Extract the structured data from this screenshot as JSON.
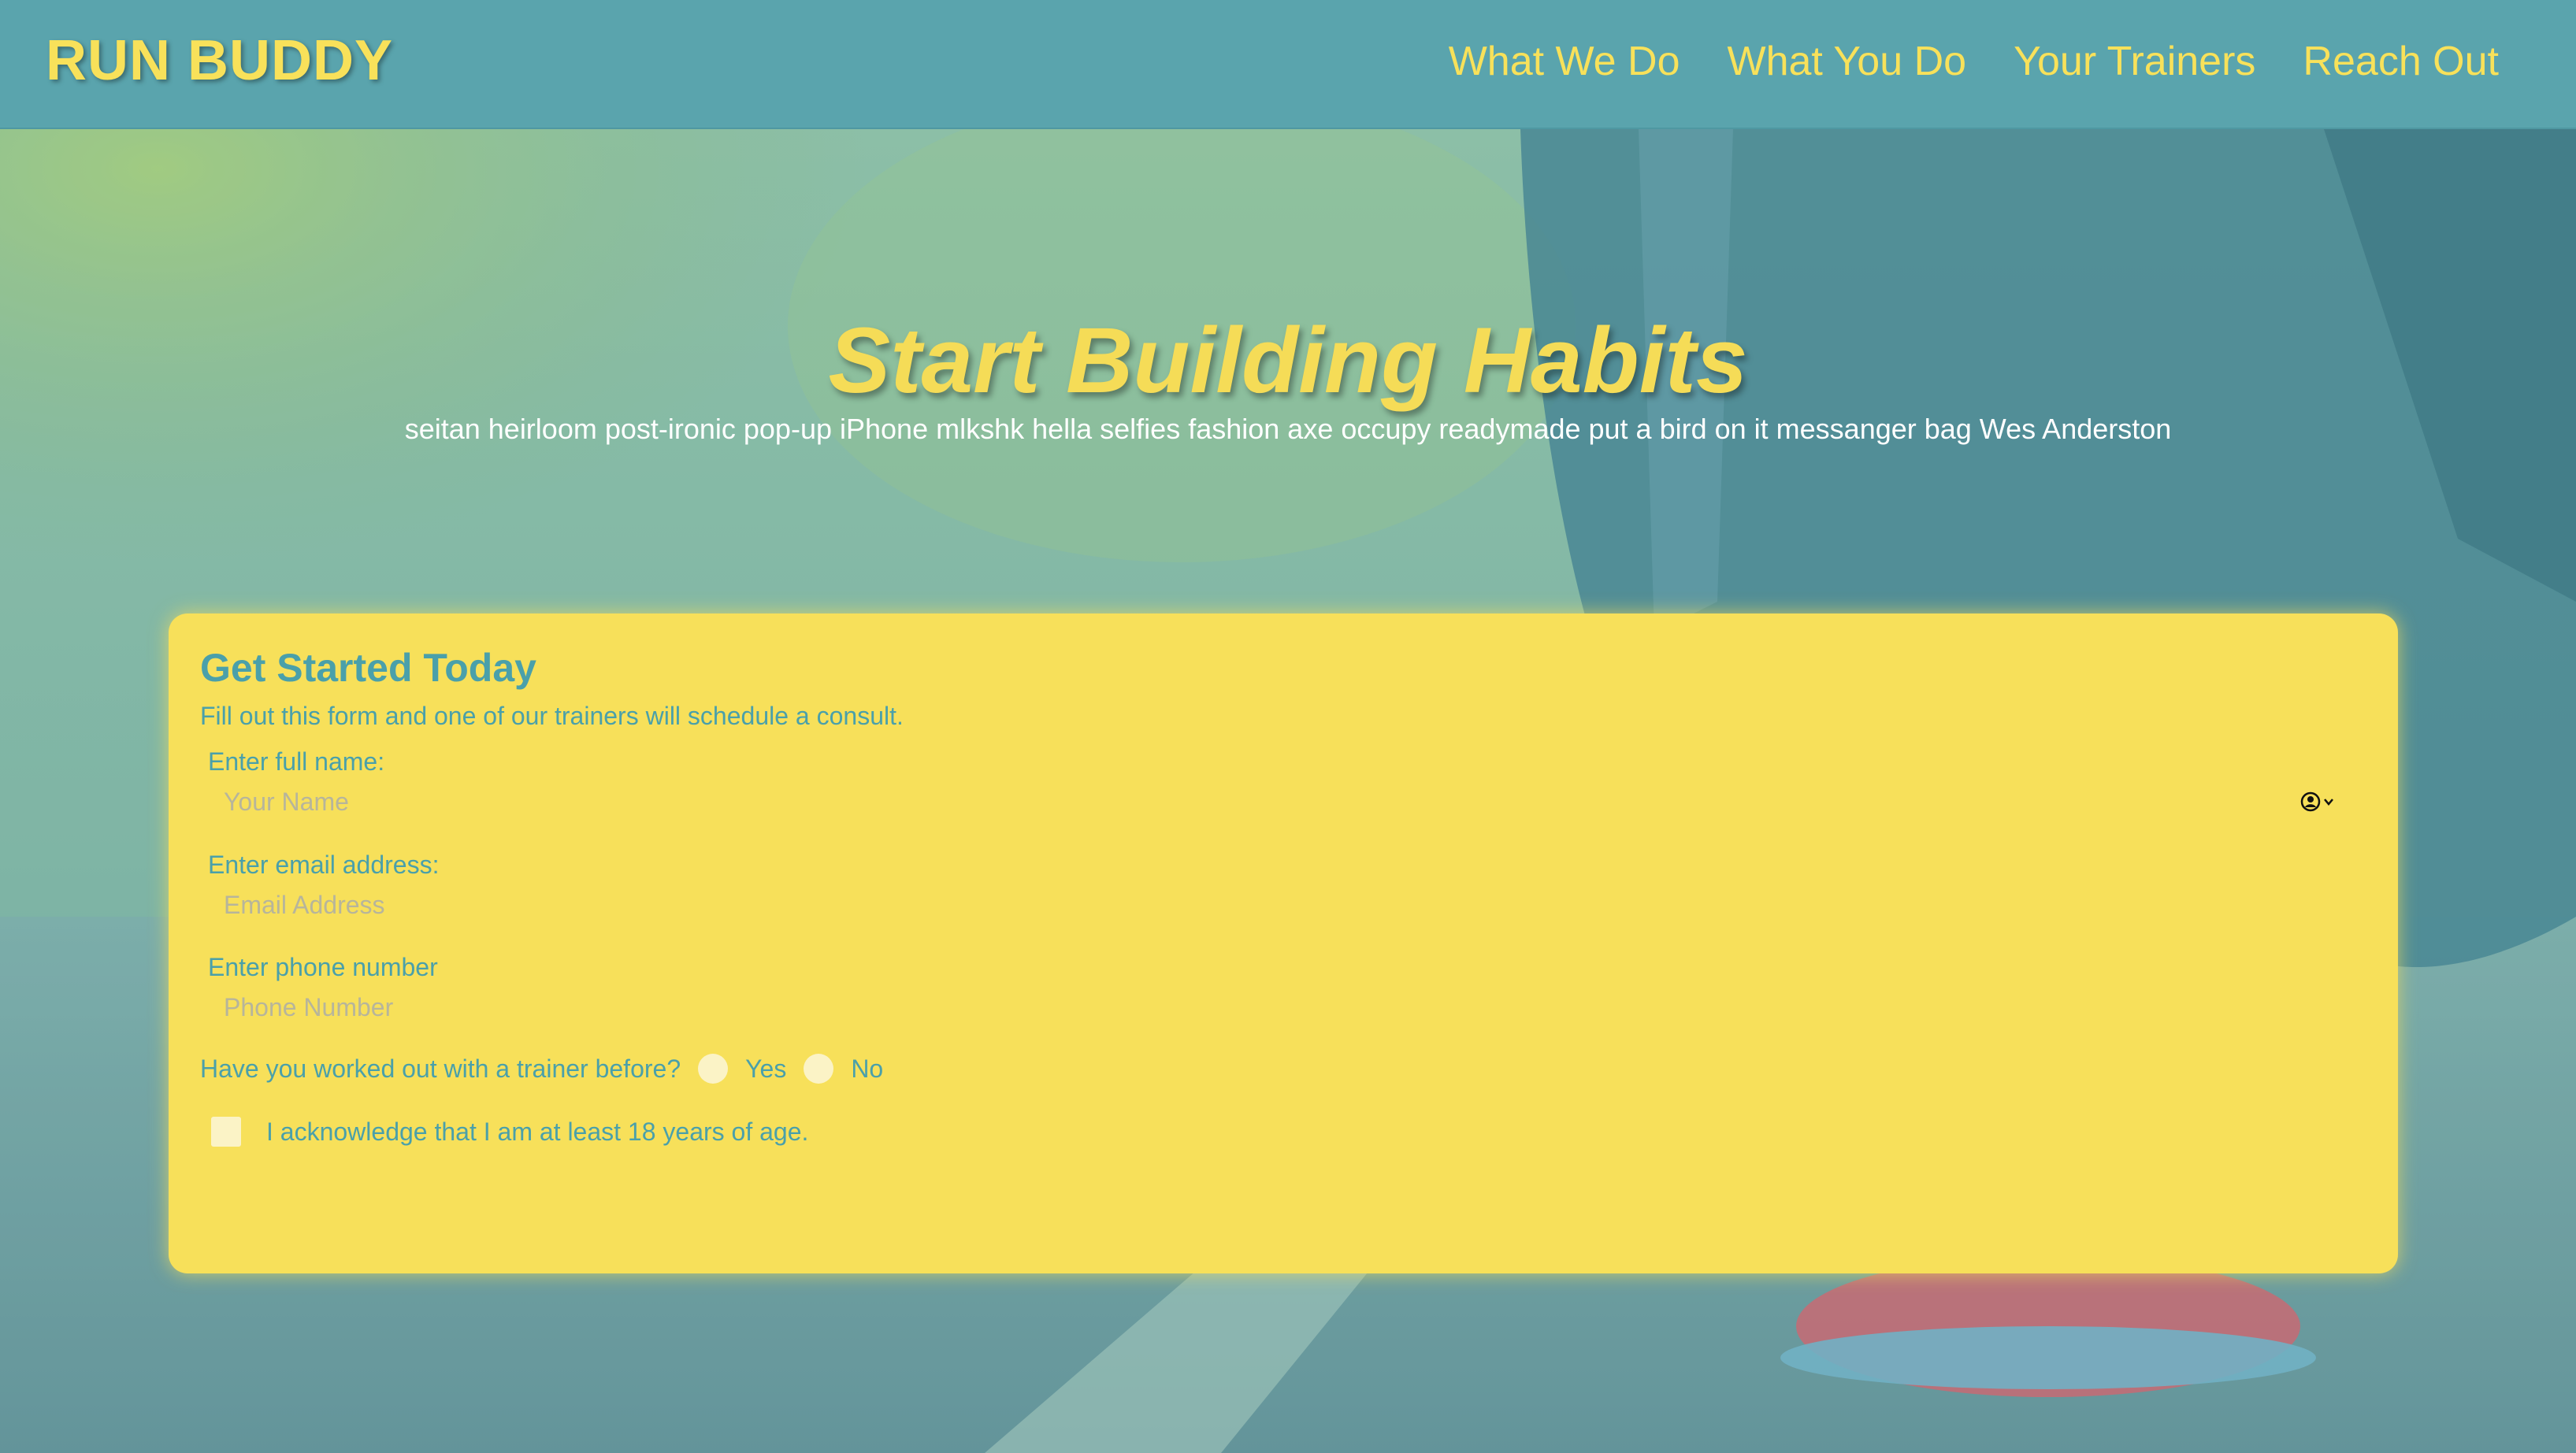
{
  "header": {
    "brand": "RUN BUDDY",
    "nav": [
      "What We Do",
      "What You Do",
      "Your Trainers",
      "Reach Out"
    ]
  },
  "hero": {
    "title": "Start Building Habits",
    "subtitle": "seitan heirloom post-ironic pop-up iPhone mlkshk hella selfies fashion axe occupy readymade put a bird on it messanger bag Wes Anderston"
  },
  "form": {
    "title": "Get Started Today",
    "description": "Fill out this form and one of our trainers will schedule a consult.",
    "fields": [
      {
        "label": "Enter full name:",
        "placeholder": "Your Name"
      },
      {
        "label": "Enter email address:",
        "placeholder": "Email Address"
      },
      {
        "label": "Enter phone number",
        "placeholder": "Phone Number"
      }
    ],
    "radio_question": "Have you worked out with a trainer before?",
    "radio_options": [
      "Yes",
      "No"
    ],
    "checkbox_label": "I acknowledge that I am at least 18 years of age."
  },
  "icons": {
    "autofill": "contact-autofill-icon"
  },
  "colors": {
    "header_bg": "#5aa4ad",
    "accent_yellow": "#f7e05a",
    "text_teal": "#4aa0aa"
  }
}
